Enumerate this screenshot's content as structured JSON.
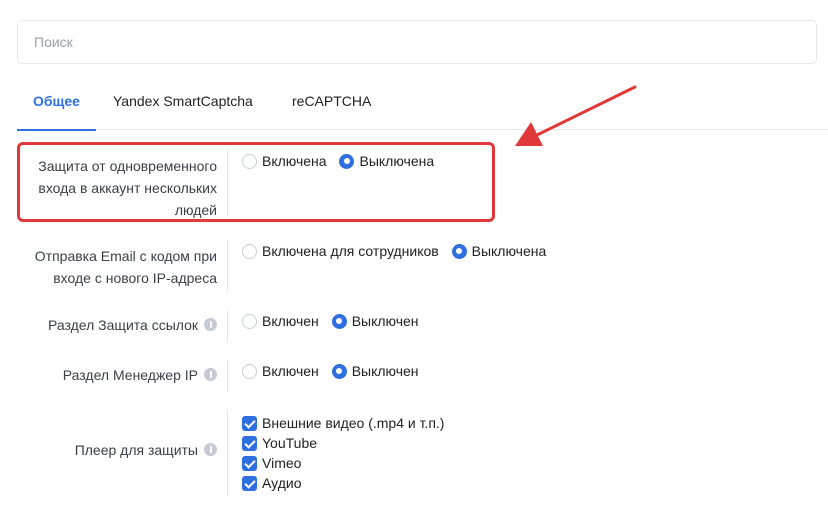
{
  "search": {
    "placeholder": "Поиск"
  },
  "tabs": [
    {
      "label": "Общее",
      "active": true
    },
    {
      "label": "Yandex SmartCaptcha",
      "active": false
    },
    {
      "label": "reCAPTCHA",
      "active": false
    }
  ],
  "settings": [
    {
      "label_lines": [
        "Защита от одновременного",
        "входа в аккаунт нескольких",
        "людей"
      ],
      "options": [
        {
          "label": "Включена",
          "checked": false
        },
        {
          "label": "Выключена",
          "checked": true
        }
      ]
    },
    {
      "label_lines": [
        "Отправка Email с кодом при",
        "входе с нового IP-адреса"
      ],
      "options": [
        {
          "label": "Включена для сотрудников",
          "checked": false
        },
        {
          "label": "Выключена",
          "checked": true
        }
      ]
    },
    {
      "label_lines": [
        "Раздел Защита ссылок"
      ],
      "info_icon": "info-icon",
      "options": [
        {
          "label": "Включен",
          "checked": false
        },
        {
          "label": "Выключен",
          "checked": true
        }
      ]
    },
    {
      "label_lines": [
        "Раздел Менеджер IP"
      ],
      "info_icon": "info-icon",
      "options": [
        {
          "label": "Включен",
          "checked": false
        },
        {
          "label": "Выключен",
          "checked": true
        }
      ]
    },
    {
      "label_lines": [
        "Плеер для защиты"
      ],
      "info_icon": "info-icon",
      "checkboxes": [
        {
          "label": "Внешние видео (.mp4 и т.п.)",
          "checked": true
        },
        {
          "label": "YouTube",
          "checked": true
        },
        {
          "label": "Vimeo",
          "checked": true
        },
        {
          "label": "Аудио",
          "checked": true
        }
      ]
    }
  ],
  "colors": {
    "accent": "#2f6fe0",
    "annotation": "#e0393a",
    "info_icon": "#c5cad3"
  }
}
